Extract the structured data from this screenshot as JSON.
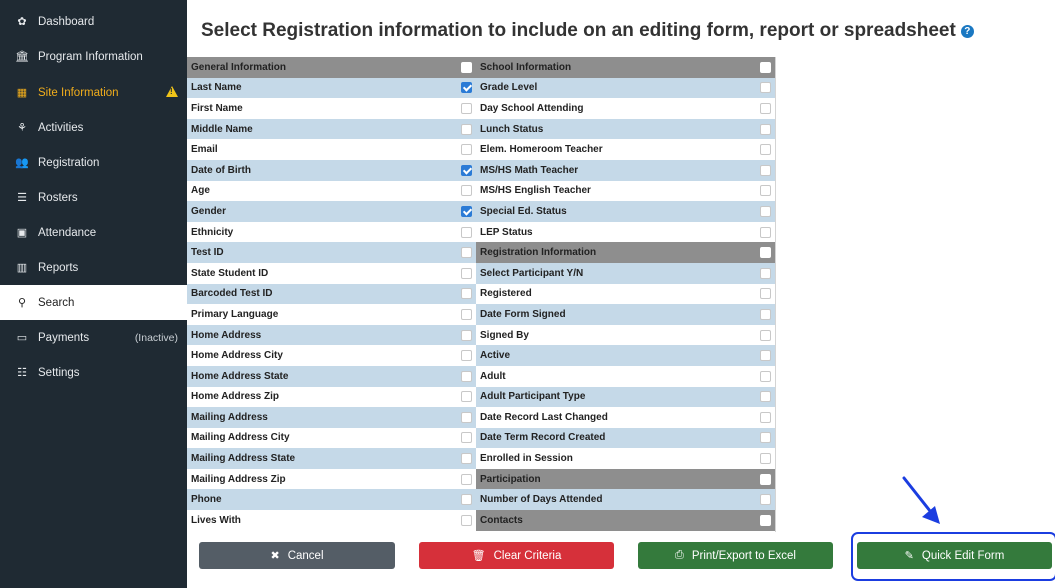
{
  "sidebar": {
    "items": [
      {
        "label": "Dashboard",
        "icon": "dashboard-icon",
        "glyph": "✿"
      },
      {
        "label": "Program Information",
        "icon": "bank-icon",
        "glyph": "🏛"
      },
      {
        "label": "Site Information",
        "icon": "building-icon",
        "glyph": "▦"
      },
      {
        "label": "Activities",
        "icon": "sitemap-icon",
        "glyph": "⚘"
      },
      {
        "label": "Registration",
        "icon": "users-icon",
        "glyph": "👥"
      },
      {
        "label": "Rosters",
        "icon": "list-icon",
        "glyph": "☰"
      },
      {
        "label": "Attendance",
        "icon": "calendar-check-icon",
        "glyph": "▣"
      },
      {
        "label": "Reports",
        "icon": "bar-chart-icon",
        "glyph": "▥"
      },
      {
        "label": "Search",
        "icon": "search-icon",
        "glyph": "⚲"
      },
      {
        "label": "Payments",
        "icon": "money-icon",
        "glyph": "▭",
        "note": "(Inactive)"
      },
      {
        "label": "Settings",
        "icon": "sliders-icon",
        "glyph": "☷"
      }
    ]
  },
  "page": {
    "title": "Select Registration information to include on an editing form, report or spreadsheet",
    "help_glyph": "?"
  },
  "left_column": [
    {
      "label": "General Information",
      "type": "header",
      "checked": false
    },
    {
      "label": "Last Name",
      "type": "alt",
      "checked": true
    },
    {
      "label": "First Name",
      "type": "plain",
      "checked": false
    },
    {
      "label": "Middle Name",
      "type": "alt",
      "checked": false
    },
    {
      "label": "Email",
      "type": "plain",
      "checked": false
    },
    {
      "label": "Date of Birth",
      "type": "alt",
      "checked": true
    },
    {
      "label": "Age",
      "type": "plain",
      "checked": false
    },
    {
      "label": "Gender",
      "type": "alt",
      "checked": true
    },
    {
      "label": "Ethnicity",
      "type": "plain",
      "checked": false
    },
    {
      "label": "Test ID",
      "type": "alt",
      "checked": false
    },
    {
      "label": "State Student ID",
      "type": "plain",
      "checked": false
    },
    {
      "label": "Barcoded Test ID",
      "type": "alt",
      "checked": false
    },
    {
      "label": "Primary Language",
      "type": "plain",
      "checked": false
    },
    {
      "label": "Home Address",
      "type": "alt",
      "checked": false
    },
    {
      "label": "Home Address City",
      "type": "plain",
      "checked": false
    },
    {
      "label": "Home Address State",
      "type": "alt",
      "checked": false
    },
    {
      "label": "Home Address Zip",
      "type": "plain",
      "checked": false
    },
    {
      "label": "Mailing Address",
      "type": "alt",
      "checked": false
    },
    {
      "label": "Mailing Address City",
      "type": "plain",
      "checked": false
    },
    {
      "label": "Mailing Address State",
      "type": "alt",
      "checked": false
    },
    {
      "label": "Mailing Address Zip",
      "type": "plain",
      "checked": false
    },
    {
      "label": "Phone",
      "type": "alt",
      "checked": false
    },
    {
      "label": "Lives With",
      "type": "plain",
      "checked": false
    }
  ],
  "right_column": [
    {
      "label": "School Information",
      "type": "header",
      "checked": false
    },
    {
      "label": "Grade Level",
      "type": "alt",
      "checked": false
    },
    {
      "label": "Day School Attending",
      "type": "plain",
      "checked": false
    },
    {
      "label": "Lunch Status",
      "type": "alt",
      "checked": false
    },
    {
      "label": "Elem. Homeroom Teacher",
      "type": "plain",
      "checked": false
    },
    {
      "label": "MS/HS Math Teacher",
      "type": "alt",
      "checked": false
    },
    {
      "label": "MS/HS English Teacher",
      "type": "plain",
      "checked": false
    },
    {
      "label": "Special Ed. Status",
      "type": "alt",
      "checked": false
    },
    {
      "label": "LEP Status",
      "type": "plain",
      "checked": false
    },
    {
      "label": "Registration Information",
      "type": "header",
      "checked": false
    },
    {
      "label": "Select Participant Y/N",
      "type": "alt",
      "checked": false
    },
    {
      "label": "Registered",
      "type": "plain",
      "checked": false
    },
    {
      "label": "Date Form Signed",
      "type": "alt",
      "checked": false
    },
    {
      "label": "Signed By",
      "type": "plain",
      "checked": false
    },
    {
      "label": "Active",
      "type": "alt",
      "checked": false
    },
    {
      "label": "Adult",
      "type": "plain",
      "checked": false
    },
    {
      "label": "Adult Participant Type",
      "type": "alt",
      "checked": false
    },
    {
      "label": "Date Record Last Changed",
      "type": "plain",
      "checked": false
    },
    {
      "label": "Date Term Record Created",
      "type": "alt",
      "checked": false
    },
    {
      "label": "Enrolled in Session",
      "type": "plain",
      "checked": false
    },
    {
      "label": "Participation",
      "type": "header",
      "checked": false
    },
    {
      "label": "Number of Days Attended",
      "type": "alt",
      "checked": false
    },
    {
      "label": "Contacts",
      "type": "header",
      "checked": false
    }
  ],
  "buttons": {
    "cancel": {
      "label": "Cancel",
      "icon": "close-icon",
      "glyph": "✖"
    },
    "clear": {
      "label": "Clear Criteria",
      "icon": "trash-icon",
      "glyph": "🗑"
    },
    "print": {
      "label": "Print/Export to Excel",
      "icon": "print-icon",
      "glyph": "⎙"
    },
    "quick": {
      "label": "Quick Edit Form",
      "icon": "edit-icon",
      "glyph": "✎"
    }
  },
  "colors": {
    "sidebar_bg": "#1f2a33",
    "highlight": "#f0ad1c",
    "row_alt": "#c5d9e8",
    "row_header": "#8e8e8e",
    "checkbox_checked": "#2b7bd6",
    "btn_cancel": "#545d66",
    "btn_clear": "#d6303a",
    "btn_green": "#347a3c",
    "annotation": "#1b3de0"
  }
}
